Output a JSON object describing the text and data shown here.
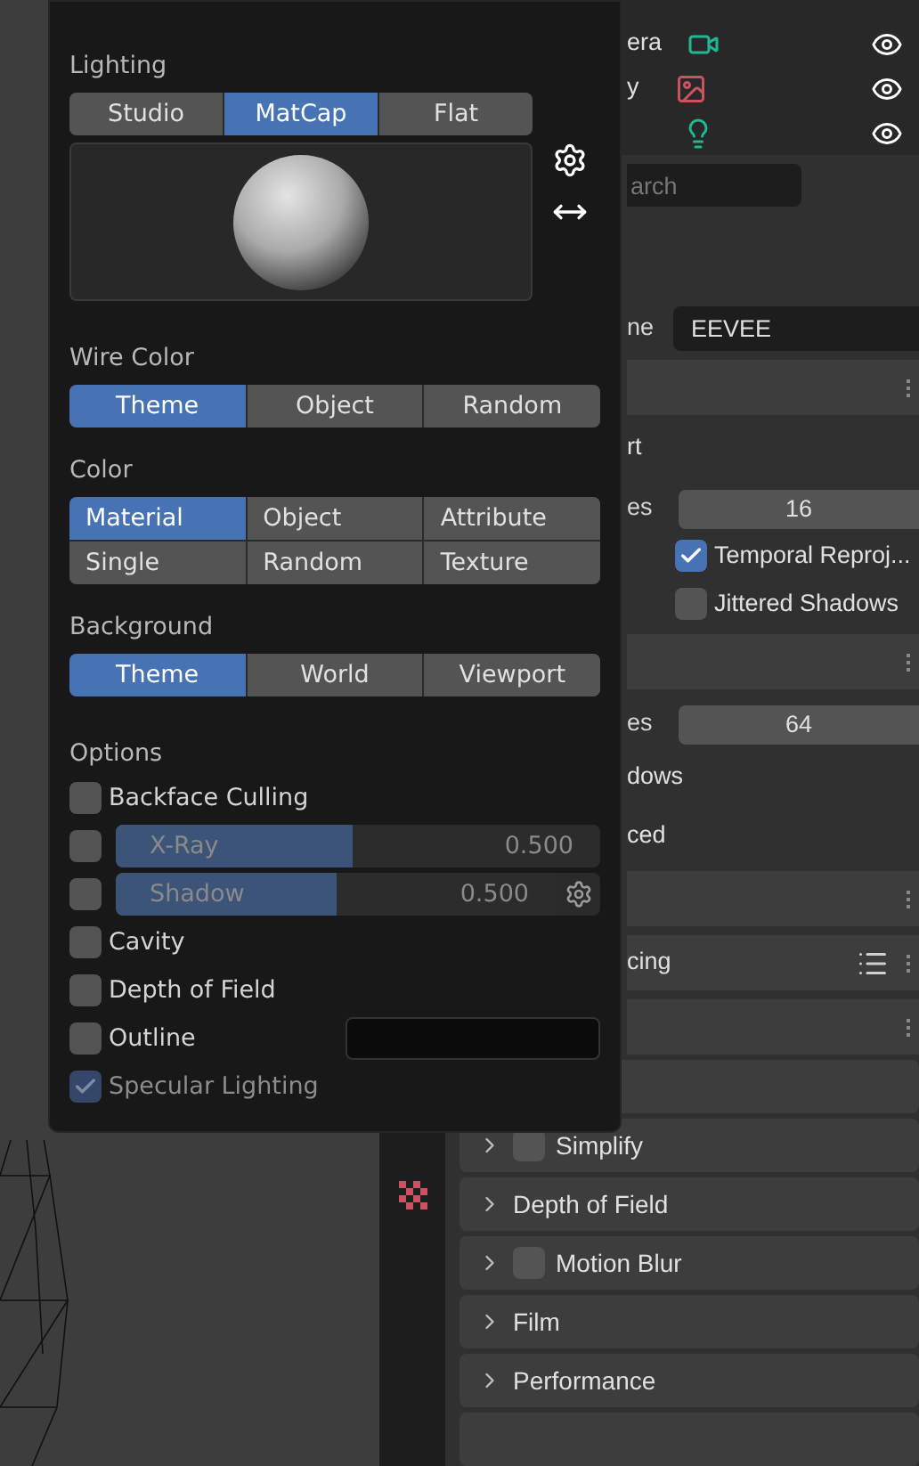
{
  "popover": {
    "lighting": {
      "label": "Lighting",
      "options": [
        {
          "label": "Studio",
          "selected": false
        },
        {
          "label": "MatCap",
          "selected": true
        },
        {
          "label": "Flat",
          "selected": false
        }
      ]
    },
    "wire_color": {
      "label": "Wire Color",
      "options": [
        {
          "label": "Theme",
          "selected": true
        },
        {
          "label": "Object",
          "selected": false
        },
        {
          "label": "Random",
          "selected": false
        }
      ]
    },
    "color": {
      "label": "Color",
      "options": [
        {
          "label": "Material",
          "selected": true
        },
        {
          "label": "Object",
          "selected": false
        },
        {
          "label": "Attribute",
          "selected": false
        },
        {
          "label": "Single",
          "selected": false
        },
        {
          "label": "Random",
          "selected": false
        },
        {
          "label": "Texture",
          "selected": false
        }
      ]
    },
    "background": {
      "label": "Background",
      "options": [
        {
          "label": "Theme",
          "selected": true
        },
        {
          "label": "World",
          "selected": false
        },
        {
          "label": "Viewport",
          "selected": false
        }
      ]
    },
    "options": {
      "label": "Options",
      "items": [
        {
          "kind": "checkbox",
          "label": "Backface Culling",
          "checked": false
        },
        {
          "kind": "slider",
          "label": "X-Ray",
          "checked": false,
          "level": 0.49,
          "reading": "0.500"
        },
        {
          "kind": "slider",
          "label": "Shadow",
          "checked": false,
          "level": 0.5,
          "reading": "0.500",
          "settings": true
        },
        {
          "kind": "checkbox",
          "label": "Cavity",
          "checked": false
        },
        {
          "kind": "checkbox",
          "label": "Depth of Field",
          "checked": false
        },
        {
          "kind": "color",
          "label": "Outline",
          "checked": false
        },
        {
          "kind": "checkbox",
          "label": "Specular Lighting",
          "checked": true,
          "disabled": true
        }
      ]
    }
  },
  "outliner": {
    "rows": [
      {
        "kind": "camera",
        "label": "era"
      },
      {
        "kind": "image",
        "label": "y"
      },
      {
        "kind": "light"
      }
    ]
  },
  "properties": {
    "search": {
      "placeholder": "arch"
    },
    "fragments": [
      {
        "kind": "menu",
        "label": "ne",
        "value": "EEVEE"
      },
      {
        "kind": "header"
      },
      {
        "kind": "text",
        "label": "rt"
      },
      {
        "kind": "number",
        "label": "es",
        "value": "16"
      },
      {
        "kind": "checkbox",
        "label": "Temporal Reproj...",
        "checked": true
      },
      {
        "kind": "checkbox",
        "label": "Jittered Shadows",
        "checked": false
      },
      {
        "kind": "header"
      },
      {
        "kind": "number",
        "label": "es",
        "value": "64"
      },
      {
        "kind": "text",
        "label": "dows"
      },
      {
        "kind": "text",
        "label": "ced"
      },
      {
        "kind": "header"
      },
      {
        "kind": "header",
        "label": "cing",
        "list": true
      },
      {
        "kind": "header"
      }
    ]
  },
  "panels": [
    {
      "kind": "checkbox",
      "label": "Simplify",
      "checked": false
    },
    {
      "kind": "plain",
      "label": "Depth of Field"
    },
    {
      "kind": "checkbox",
      "label": "Motion Blur",
      "checked": false
    },
    {
      "kind": "plain",
      "label": "Film"
    },
    {
      "kind": "plain",
      "label": "Performance"
    }
  ]
}
